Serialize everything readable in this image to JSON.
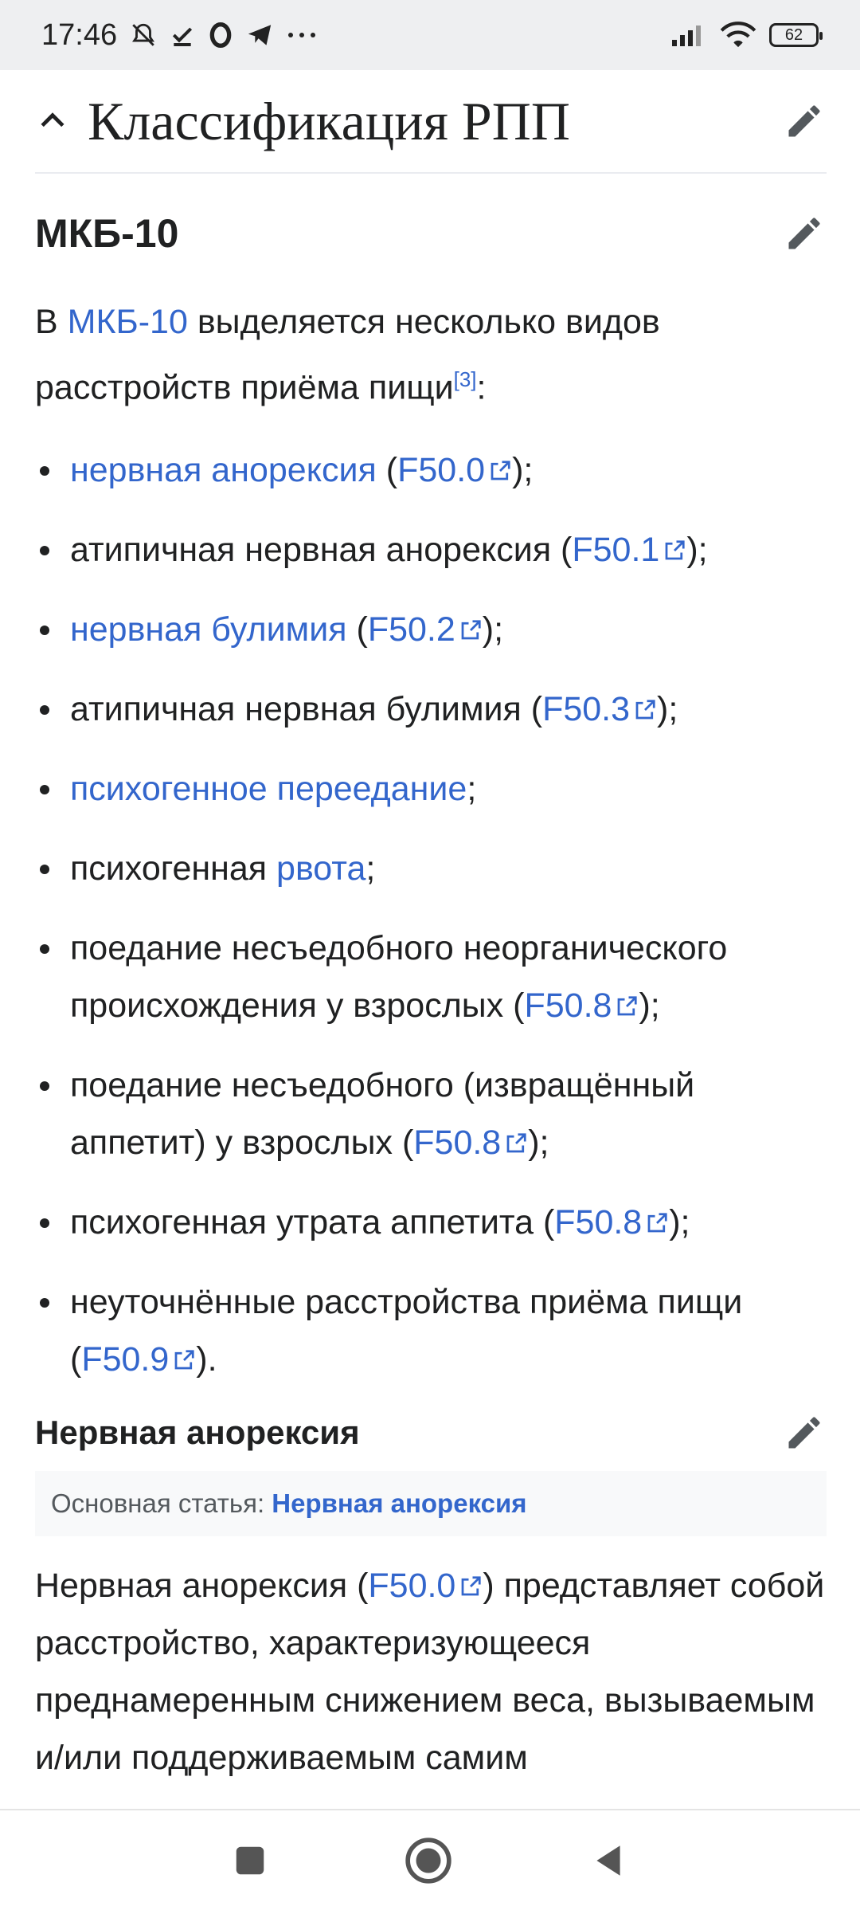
{
  "status_bar": {
    "time": "17:46",
    "battery": "62"
  },
  "section": {
    "title": "Классификация РПП"
  },
  "subsection": {
    "title": "МКБ-10"
  },
  "intro": {
    "before": "В ",
    "link": "МКБ-10",
    "after": " выделяется несколько видов расстройств приёма пищи",
    "ref": "[3]",
    "tail": ":"
  },
  "items": [
    {
      "link": "нервная анорексия",
      "open": " (",
      "code": "F50.0",
      "close": ");"
    },
    {
      "text": "атипичная нервная анорексия (",
      "code": "F50.1",
      "close": ");"
    },
    {
      "link": "нервная булимия",
      "open": " (",
      "code": "F50.2",
      "close": ");"
    },
    {
      "text": "атипичная нервная булимия (",
      "code": "F50.3",
      "close": ");"
    },
    {
      "link": "психогенное переедание",
      "close": ";"
    },
    {
      "text": "психогенная ",
      "link": "рвота",
      "close": ";"
    },
    {
      "text": "поедание несъедобного неорганического происхождения у взрослых (",
      "code": "F50.8",
      "close": ");"
    },
    {
      "text": "поедание несъедобного (извращённый аппетит) у взрослых (",
      "code": "F50.8",
      "close": ");"
    },
    {
      "text": "психогенная утрата аппетита (",
      "code": "F50.8",
      "close": ");"
    },
    {
      "text": "неуточнённые расстройства приёма пищи (",
      "code": "F50.9",
      "close": ")."
    }
  ],
  "anorexia": {
    "title": "Нервная анорексия",
    "hatnote_label": "Основная статья: ",
    "hatnote_link": "Нервная анорексия",
    "p_before": "Нервная анорексия (",
    "p_code": "F50.0",
    "p_after": ") представляет собой расстройство, характеризующееся преднамеренным снижением веса, вызываемым и/или поддерживаемым самим"
  },
  "colors": {
    "link": "#3366cc",
    "text": "#202122",
    "statusbar_bg": "#eeeff1"
  }
}
